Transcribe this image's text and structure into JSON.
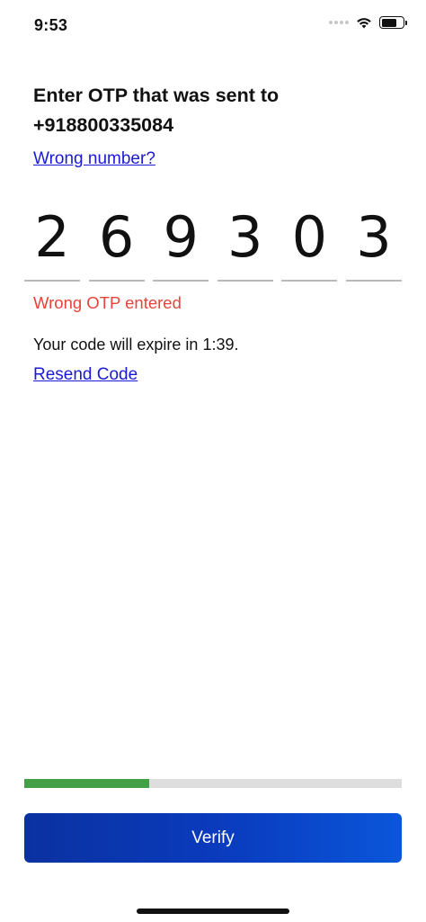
{
  "status_bar": {
    "time": "9:53",
    "icons": [
      "cellular-signal-icon",
      "wifi-icon",
      "battery-icon"
    ]
  },
  "header": {
    "title": "Enter OTP that was sent to +918800335084",
    "wrong_number_link": "Wrong number?"
  },
  "otp": {
    "digits": [
      "2",
      "6",
      "9",
      "3",
      "0",
      "3"
    ]
  },
  "error_message": "Wrong OTP entered",
  "expiry_text": "Your code will expire in 1:39.",
  "resend_link": "Resend Code",
  "progress": {
    "fraction": 0.33
  },
  "verify_button": {
    "label": "Verify"
  },
  "colors": {
    "error": "#e5443a",
    "link": "#1a1ad6",
    "progress_fill": "#43a047",
    "progress_track": "#dddddd",
    "button_start": "#0a31a0",
    "button_end": "#0a56da"
  }
}
